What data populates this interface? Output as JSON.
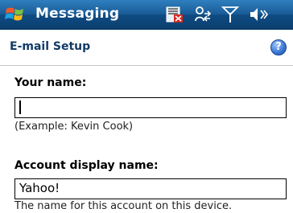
{
  "titlebar": {
    "title": "Messaging"
  },
  "header": {
    "title": "E-mail Setup"
  },
  "form": {
    "your_name_label": "Your name:",
    "your_name_value": "",
    "your_name_hint": "(Example: Kevin Cook)",
    "account_display_label": "Account display name:",
    "account_display_value": "Yahoo!",
    "account_display_hint": "The name for this account on this device."
  },
  "icons": {
    "start": "windows-start-icon",
    "storage_card": "storage-card-error-icon",
    "connectivity": "data-connection-icon",
    "signal": "signal-strength-icon",
    "volume": "speaker-off-icon",
    "help": "help-icon"
  },
  "colors": {
    "titlebar": "#1a5c97",
    "page_title": "#123a66",
    "help": "#3f7bd6"
  }
}
